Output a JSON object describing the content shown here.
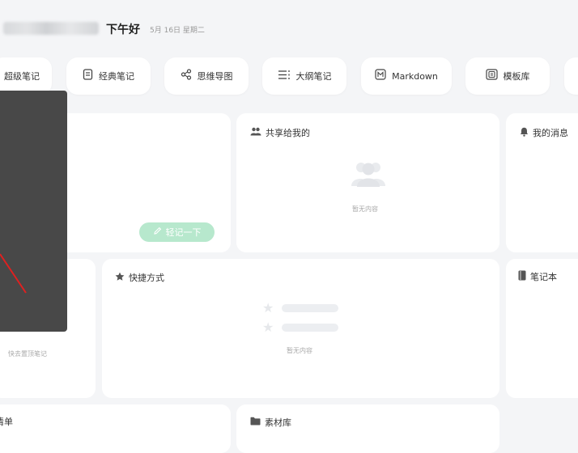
{
  "header": {
    "greeting": "下午好",
    "date": "5月 16日 星期二"
  },
  "tools": [
    {
      "label": "超级笔记",
      "icon": "super-note-icon"
    },
    {
      "label": "经典笔记",
      "icon": "classic-note-icon"
    },
    {
      "label": "思维导图",
      "icon": "mind-map-icon"
    },
    {
      "label": "大纲笔记",
      "icon": "outline-note-icon"
    },
    {
      "label": "Markdown",
      "icon": "markdown-icon"
    },
    {
      "label": "模板库",
      "icon": "template-library-icon"
    }
  ],
  "cards": {
    "quick_note": {
      "button_label": "轻记一下"
    },
    "shared": {
      "title": "共享给我的",
      "empty_text": "暂无内容"
    },
    "messages": {
      "title": "我的消息"
    },
    "pinned": {
      "empty_text": "快去置顶笔记"
    },
    "shortcuts": {
      "title": "快捷方式",
      "empty_text": "暂无内容"
    },
    "notebook": {
      "title": "笔记本"
    },
    "list": {
      "title": "清单"
    },
    "materials": {
      "title": "素材库"
    }
  },
  "colors": {
    "accent_green": "#b7e8cd",
    "overlay": "#484848",
    "arrow": "#e02020"
  }
}
